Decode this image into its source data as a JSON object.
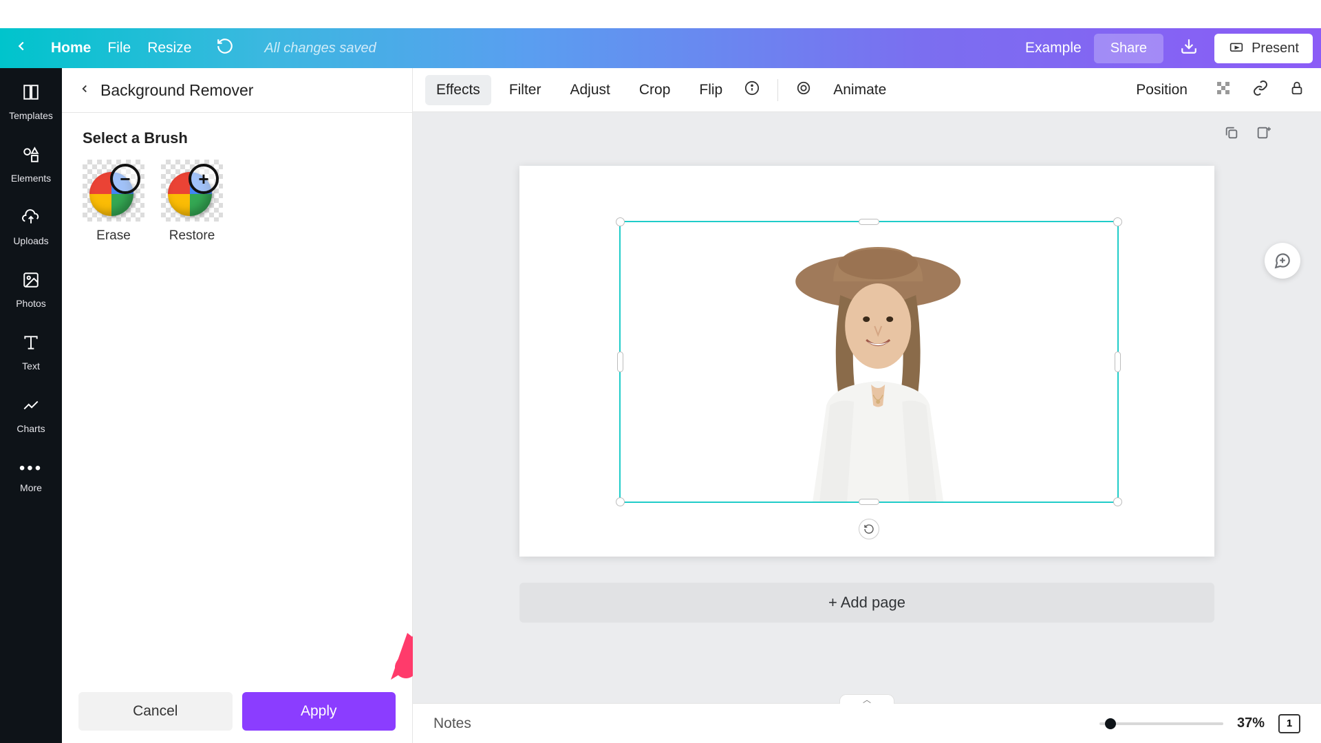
{
  "header": {
    "home": "Home",
    "file": "File",
    "resize": "Resize",
    "saved": "All changes saved",
    "example": "Example",
    "share": "Share",
    "present": "Present"
  },
  "rail": {
    "templates": "Templates",
    "elements": "Elements",
    "uploads": "Uploads",
    "photos": "Photos",
    "text": "Text",
    "charts": "Charts",
    "more": "More"
  },
  "panel": {
    "title": "Background Remover",
    "brush_heading": "Select a Brush",
    "erase": "Erase",
    "restore": "Restore",
    "cancel": "Cancel",
    "apply": "Apply"
  },
  "toolbar": {
    "effects": "Effects",
    "filter": "Filter",
    "adjust": "Adjust",
    "crop": "Crop",
    "flip": "Flip",
    "animate": "Animate",
    "position": "Position"
  },
  "editor": {
    "add_page": "+ Add page"
  },
  "footer": {
    "notes": "Notes",
    "zoom": "37%",
    "page_count": "1"
  }
}
